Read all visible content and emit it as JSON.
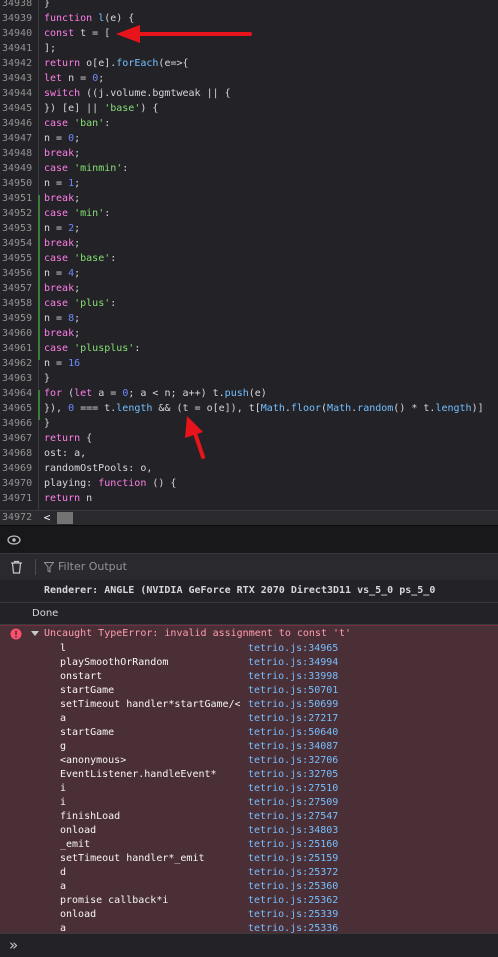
{
  "editor": {
    "lines": [
      {
        "n": "34938",
        "t": [
          [
            "pl",
            "}"
          ]
        ]
      },
      {
        "n": "34939",
        "t": [
          [
            "kw",
            "function "
          ],
          [
            "fn",
            "l"
          ],
          [
            "pl",
            "(e) {"
          ]
        ]
      },
      {
        "n": "34940",
        "t": [
          [
            "kw",
            "const "
          ],
          [
            "pl",
            "t = ["
          ]
        ]
      },
      {
        "n": "34941",
        "t": [
          [
            "pl",
            "];"
          ]
        ]
      },
      {
        "n": "34942",
        "t": [
          [
            "kw",
            "return "
          ],
          [
            "pl",
            "o[e]."
          ],
          [
            "fn",
            "forEach"
          ],
          [
            "pl",
            "(e=>{"
          ]
        ]
      },
      {
        "n": "34943",
        "t": [
          [
            "kw",
            "let "
          ],
          [
            "pl",
            "n = "
          ],
          [
            "num",
            "0"
          ],
          [
            "pl",
            ";"
          ]
        ]
      },
      {
        "n": "34944",
        "t": [
          [
            "kw",
            "switch "
          ],
          [
            "pl",
            "((j.volume.bgmtweak || {"
          ]
        ]
      },
      {
        "n": "34945",
        "t": [
          [
            "pl",
            "}) [e] || "
          ],
          [
            "str",
            "'base'"
          ],
          [
            "pl",
            ") {"
          ]
        ]
      },
      {
        "n": "34946",
        "t": [
          [
            "kw",
            "case "
          ],
          [
            "str",
            "'ban'"
          ],
          [
            "pl",
            ":"
          ]
        ]
      },
      {
        "n": "34947",
        "t": [
          [
            "pl",
            "n = "
          ],
          [
            "num",
            "0"
          ],
          [
            "pl",
            ";"
          ]
        ]
      },
      {
        "n": "34948",
        "t": [
          [
            "kw",
            "break"
          ],
          [
            "pl",
            ";"
          ]
        ]
      },
      {
        "n": "34949",
        "t": [
          [
            "kw",
            "case "
          ],
          [
            "str",
            "'minmin'"
          ],
          [
            "pl",
            ":"
          ]
        ]
      },
      {
        "n": "34950",
        "t": [
          [
            "pl",
            "n = "
          ],
          [
            "num",
            "1"
          ],
          [
            "pl",
            ";"
          ]
        ]
      },
      {
        "n": "34951",
        "t": [
          [
            "kw",
            "break"
          ],
          [
            "pl",
            ";"
          ]
        ]
      },
      {
        "n": "34952",
        "t": [
          [
            "kw",
            "case "
          ],
          [
            "str",
            "'min'"
          ],
          [
            "pl",
            ":"
          ]
        ]
      },
      {
        "n": "34953",
        "t": [
          [
            "pl",
            "n = "
          ],
          [
            "num",
            "2"
          ],
          [
            "pl",
            ";"
          ]
        ]
      },
      {
        "n": "34954",
        "t": [
          [
            "kw",
            "break"
          ],
          [
            "pl",
            ";"
          ]
        ]
      },
      {
        "n": "34955",
        "t": [
          [
            "kw",
            "case "
          ],
          [
            "str",
            "'base'"
          ],
          [
            "pl",
            ":"
          ]
        ]
      },
      {
        "n": "34956",
        "t": [
          [
            "pl",
            "n = "
          ],
          [
            "num",
            "4"
          ],
          [
            "pl",
            ";"
          ]
        ]
      },
      {
        "n": "34957",
        "t": [
          [
            "kw",
            "break"
          ],
          [
            "pl",
            ";"
          ]
        ]
      },
      {
        "n": "34958",
        "t": [
          [
            "kw",
            "case "
          ],
          [
            "str",
            "'plus'"
          ],
          [
            "pl",
            ":"
          ]
        ]
      },
      {
        "n": "34959",
        "t": [
          [
            "pl",
            "n = "
          ],
          [
            "num",
            "8"
          ],
          [
            "pl",
            ";"
          ]
        ]
      },
      {
        "n": "34960",
        "t": [
          [
            "kw",
            "break"
          ],
          [
            "pl",
            ";"
          ]
        ]
      },
      {
        "n": "34961",
        "t": [
          [
            "kw",
            "case "
          ],
          [
            "str",
            "'plusplus'"
          ],
          [
            "pl",
            ":"
          ]
        ]
      },
      {
        "n": "34962",
        "t": [
          [
            "pl",
            "n = "
          ],
          [
            "num",
            "16"
          ]
        ]
      },
      {
        "n": "34963",
        "t": [
          [
            "pl",
            "}"
          ]
        ]
      },
      {
        "n": "34964",
        "t": [
          [
            "kw",
            "for "
          ],
          [
            "pl",
            "("
          ],
          [
            "kw",
            "let "
          ],
          [
            "pl",
            "a = "
          ],
          [
            "num",
            "0"
          ],
          [
            "pl",
            "; a < n; a++) t."
          ],
          [
            "fn",
            "push"
          ],
          [
            "pl",
            "(e)"
          ]
        ]
      },
      {
        "n": "34965",
        "t": [
          [
            "pl",
            "}), "
          ],
          [
            "num",
            "0"
          ],
          [
            "pl",
            " === t."
          ],
          [
            "fn",
            "length"
          ],
          [
            "pl",
            " && (t = o[e]), t["
          ],
          [
            "fn",
            "Math"
          ],
          [
            "pl",
            "."
          ],
          [
            "fn",
            "floor"
          ],
          [
            "pl",
            "("
          ],
          [
            "fn",
            "Math"
          ],
          [
            "pl",
            "."
          ],
          [
            "fn",
            "random"
          ],
          [
            "pl",
            "() * t."
          ],
          [
            "fn",
            "length"
          ],
          [
            "pl",
            ")]"
          ]
        ]
      },
      {
        "n": "34966",
        "t": [
          [
            "pl",
            "}"
          ]
        ]
      },
      {
        "n": "34967",
        "t": [
          [
            "kw",
            "return "
          ],
          [
            "pl",
            "{"
          ]
        ]
      },
      {
        "n": "34968",
        "t": [
          [
            "pl",
            "ost: a,"
          ]
        ]
      },
      {
        "n": "34969",
        "t": [
          [
            "pl",
            "randomOstPools: o,"
          ]
        ]
      },
      {
        "n": "34970",
        "t": [
          [
            "pl",
            "playing: "
          ],
          [
            "kw",
            "function "
          ],
          [
            "pl",
            "() {"
          ]
        ]
      },
      {
        "n": "34971",
        "t": [
          [
            "kw",
            "return "
          ],
          [
            "pl",
            "n"
          ]
        ]
      }
    ],
    "last_line_number": "34972",
    "scroll_left_arrow": "<"
  },
  "console": {
    "filter_placeholder": "Filter Output",
    "renderer_message": "Renderer: ANGLE (NVIDIA GeForce RTX 2070 Direct3D11 vs_5_0 ps_5_0",
    "done_message": "Done",
    "error_message": "Uncaught TypeError: invalid assignment to const 't'",
    "stack": [
      {
        "f": "l",
        "loc": "tetrio.js:34965"
      },
      {
        "f": "playSmoothOrRandom",
        "loc": "tetrio.js:34994"
      },
      {
        "f": "onstart",
        "loc": "tetrio.js:33998"
      },
      {
        "f": "startGame",
        "loc": "tetrio.js:50701"
      },
      {
        "f": "setTimeout handler*startGame/<",
        "loc": "tetrio.js:50699"
      },
      {
        "f": "a",
        "loc": "tetrio.js:27217"
      },
      {
        "f": "startGame",
        "loc": "tetrio.js:50640"
      },
      {
        "f": "g",
        "loc": "tetrio.js:34087"
      },
      {
        "f": "<anonymous>",
        "loc": "tetrio.js:32706"
      },
      {
        "f": "EventListener.handleEvent*",
        "loc": "tetrio.js:32705"
      },
      {
        "f": "i",
        "loc": "tetrio.js:27510"
      },
      {
        "f": "i",
        "loc": "tetrio.js:27509"
      },
      {
        "f": "finishLoad",
        "loc": "tetrio.js:27547"
      },
      {
        "f": "onload",
        "loc": "tetrio.js:34803"
      },
      {
        "f": "_emit",
        "loc": "tetrio.js:25160"
      },
      {
        "f": "setTimeout handler*_emit",
        "loc": "tetrio.js:25159"
      },
      {
        "f": "d",
        "loc": "tetrio.js:25372"
      },
      {
        "f": "a",
        "loc": "tetrio.js:25360"
      },
      {
        "f": "promise callback*i",
        "loc": "tetrio.js:25362"
      },
      {
        "f": "onload",
        "loc": "tetrio.js:25339"
      },
      {
        "f": "a",
        "loc": "tetrio.js:25336"
      }
    ],
    "prompt_symbol": "»"
  },
  "colors": {
    "keyword": "#ff7de9",
    "string": "#86de74",
    "number": "#6b89ff",
    "function": "#75bfff",
    "error_bg": "#4b2f36",
    "annotation_arrow": "#e8141c"
  },
  "icons": [
    "eye-icon",
    "trash-icon",
    "filter-icon",
    "error-icon",
    "chevron-down-icon",
    "console-prompt-icon"
  ]
}
